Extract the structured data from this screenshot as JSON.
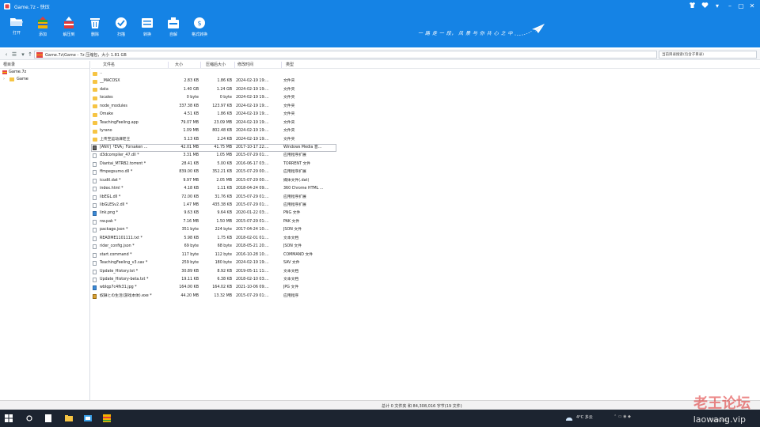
{
  "window": {
    "title": "Game.7z - 快压",
    "controls": [
      "shirt-icon",
      "heart-icon",
      "chevron-down-icon",
      "minimize-icon",
      "maximize-icon",
      "close-icon"
    ]
  },
  "toolbar": {
    "items": [
      {
        "label": "打开",
        "icon": "folder-open-icon"
      },
      {
        "label": "添加",
        "icon": "add-archive-icon"
      },
      {
        "label": "解压到",
        "icon": "extract-icon"
      },
      {
        "label": "删除",
        "icon": "trash-icon"
      },
      {
        "label": "扫描",
        "icon": "scan-icon"
      },
      {
        "label": "转换",
        "icon": "convert-icon"
      },
      {
        "label": "自解",
        "icon": "self-extract-icon"
      },
      {
        "label": "格式转换",
        "icon": "format-convert-icon"
      }
    ],
    "slogan": "一 路 走 一 段，  风 景 与 你 共 心 之 中"
  },
  "address": {
    "path": "Game.7z\\Game - 7z 压缩包，大小 1.81 GB",
    "search_placeholder": "当前目录搜索(包含子目录)"
  },
  "tree": {
    "header": "根目录",
    "items": [
      {
        "label": "Game.7z",
        "type": "archive"
      },
      {
        "label": "Game",
        "type": "folder"
      }
    ]
  },
  "columns": [
    "文件名",
    "大小",
    "压缩后大小",
    "修改时间",
    "类型"
  ],
  "files": [
    {
      "name": "..",
      "size": "",
      "packed": "",
      "date": "",
      "type": "",
      "icon": "folder"
    },
    {
      "name": "__MACOSX",
      "size": "2.83 KB",
      "packed": "1.86 KB",
      "date": "2024-02-19  19:...",
      "type": "文件夹",
      "icon": "folder"
    },
    {
      "name": "data",
      "size": "1.40 GB",
      "packed": "1.24 GB",
      "date": "2024-02-19  19:...",
      "type": "文件夹",
      "icon": "folder"
    },
    {
      "name": "locales",
      "size": "0 byte",
      "packed": "0 byte",
      "date": "2024-02-19  19:...",
      "type": "文件夹",
      "icon": "folder"
    },
    {
      "name": "node_modules",
      "size": "337.38 KB",
      "packed": "123.97 KB",
      "date": "2024-02-19  19:...",
      "type": "文件夹",
      "icon": "folder"
    },
    {
      "name": "Omake",
      "size": "4.51 KB",
      "packed": "1.86 KB",
      "date": "2024-02-19  19:...",
      "type": "文件夹",
      "icon": "folder"
    },
    {
      "name": "TeachingFeeling.app",
      "size": "79.07 MB",
      "packed": "23.09 MB",
      "date": "2024-02-19  19:...",
      "type": "文件夹",
      "icon": "folder"
    },
    {
      "name": "tyrano",
      "size": "1.09 MB",
      "packed": "802.48 KB",
      "date": "2024-02-19  19:...",
      "type": "文件夹",
      "icon": "folder"
    },
    {
      "name": "上传至运动课老王",
      "size": "5.13 KB",
      "packed": "2.24 KB",
      "date": "2024-02-19  19:...",
      "type": "文件夹",
      "icon": "folder"
    },
    {
      "name": "[ANV]「EVA」Forsaken ...",
      "size": "42.01 MB",
      "packed": "41.75 MB",
      "date": "2017-10-17  22:...",
      "type": "Windows Media 音...",
      "icon": "media",
      "selected": true
    },
    {
      "name": "d3dcompiler_47.dll *",
      "size": "3.31 MB",
      "packed": "1.05 MB",
      "date": "2015-07-29  01:...",
      "type": "应用程序扩展",
      "icon": "file"
    },
    {
      "name": "Diantai_MTRB2.torrent *",
      "size": "28.41 KB",
      "packed": "5.00 KB",
      "date": "2016-06-17  03:...",
      "type": "TORRENT 文件",
      "icon": "file"
    },
    {
      "name": "ffmpegsumo.dll *",
      "size": "839.00 KB",
      "packed": "352.21 KB",
      "date": "2015-07-29  00:...",
      "type": "应用程序扩展",
      "icon": "file"
    },
    {
      "name": "icudtl.dat *",
      "size": "9.97 MB",
      "packed": "2.05 MB",
      "date": "2015-07-29  00:...",
      "type": "媒体文件(.dat)",
      "icon": "file"
    },
    {
      "name": "index.html *",
      "size": "4.18 KB",
      "packed": "1.11 KB",
      "date": "2018-04-24  09:...",
      "type": "360 Chrome HTML ...",
      "icon": "file"
    },
    {
      "name": "libEGL.dll *",
      "size": "72.00 KB",
      "packed": "31.76 KB",
      "date": "2015-07-29  01:...",
      "type": "应用程序扩展",
      "icon": "file"
    },
    {
      "name": "libGLESv2.dll *",
      "size": "1.47 MB",
      "packed": "435.38 KB",
      "date": "2015-07-29  01:...",
      "type": "应用程序扩展",
      "icon": "file"
    },
    {
      "name": "link.png *",
      "size": "9.63 KB",
      "packed": "9.64 KB",
      "date": "2020-01-22  03:...",
      "type": "PNG 文件",
      "icon": "img"
    },
    {
      "name": "nw.pak *",
      "size": "7.16 MB",
      "packed": "1.50 MB",
      "date": "2015-07-29  01:...",
      "type": "PAK 文件",
      "icon": "file"
    },
    {
      "name": "package.json *",
      "size": "351 byte",
      "packed": "224 byte",
      "date": "2017-04-24  10:...",
      "type": "JSON 文件",
      "icon": "file"
    },
    {
      "name": "README1101111.txt *",
      "size": "5.98 KB",
      "packed": "1.75 KB",
      "date": "2018-02-01  01:...",
      "type": "文本文档",
      "icon": "file"
    },
    {
      "name": "rider_config.json *",
      "size": "69 byte",
      "packed": "68 byte",
      "date": "2018-05-21  20:...",
      "type": "JSON 文件",
      "icon": "file"
    },
    {
      "name": "start.command *",
      "size": "117 byte",
      "packed": "112 byte",
      "date": "2016-10-28  10:...",
      "type": "COMMAND 文件",
      "icon": "file"
    },
    {
      "name": "TeachingFeeling_v3.sav *",
      "size": "259 byte",
      "packed": "180 byte",
      "date": "2024-02-19  19:...",
      "type": "SAV 文件",
      "icon": "file"
    },
    {
      "name": "Update_History.txt *",
      "size": "30.89 KB",
      "packed": "8.92 KB",
      "date": "2019-05-11  11:...",
      "type": "文本文档",
      "icon": "file"
    },
    {
      "name": "Update_History-beta.txt *",
      "size": "19.11 KB",
      "packed": "6.38 KB",
      "date": "2018-02-10  03:...",
      "type": "文本文档",
      "icon": "file"
    },
    {
      "name": "wbIqp7c4fk31.jpg *",
      "size": "164.00 KB",
      "packed": "164.02 KB",
      "date": "2021-10-06  09:...",
      "type": "JPG 文件",
      "icon": "img"
    },
    {
      "name": "奴隷との生活(游戏本体).exe *",
      "size": "44.20 MB",
      "packed": "13.32 MB",
      "date": "2015-07-29  01:...",
      "type": "应用程序",
      "icon": "exe"
    }
  ],
  "status": {
    "text": "总计 0 文件夹 和 84,308,016 字节(19 文件)"
  },
  "taskbar": {
    "weather": "4°C  多云",
    "time": "2024/2/19"
  },
  "watermark": {
    "text": "老王论坛",
    "url": "laowang.vip"
  },
  "colors": {
    "toolbar_bg": "#1583e5",
    "folder": "#f6c443",
    "taskbar_bg": "#1c2430"
  }
}
